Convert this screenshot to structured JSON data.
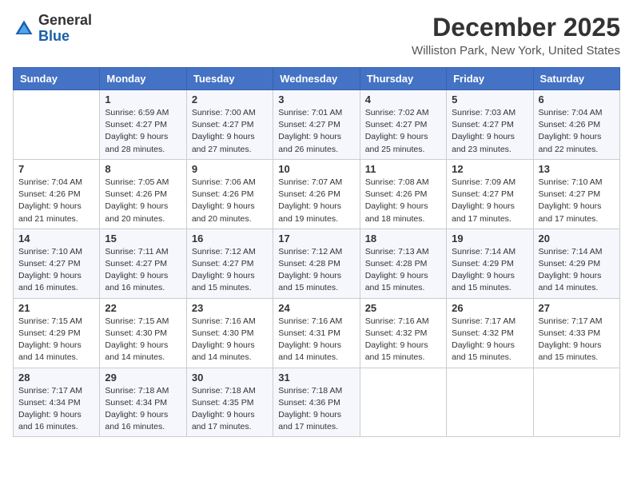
{
  "logo": {
    "general": "General",
    "blue": "Blue"
  },
  "header": {
    "month": "December 2025",
    "location": "Williston Park, New York, United States"
  },
  "weekdays": [
    "Sunday",
    "Monday",
    "Tuesday",
    "Wednesday",
    "Thursday",
    "Friday",
    "Saturday"
  ],
  "weeks": [
    [
      {
        "day": "",
        "sunrise": "",
        "sunset": "",
        "daylight": ""
      },
      {
        "day": "1",
        "sunrise": "Sunrise: 6:59 AM",
        "sunset": "Sunset: 4:27 PM",
        "daylight": "Daylight: 9 hours and 28 minutes."
      },
      {
        "day": "2",
        "sunrise": "Sunrise: 7:00 AM",
        "sunset": "Sunset: 4:27 PM",
        "daylight": "Daylight: 9 hours and 27 minutes."
      },
      {
        "day": "3",
        "sunrise": "Sunrise: 7:01 AM",
        "sunset": "Sunset: 4:27 PM",
        "daylight": "Daylight: 9 hours and 26 minutes."
      },
      {
        "day": "4",
        "sunrise": "Sunrise: 7:02 AM",
        "sunset": "Sunset: 4:27 PM",
        "daylight": "Daylight: 9 hours and 25 minutes."
      },
      {
        "day": "5",
        "sunrise": "Sunrise: 7:03 AM",
        "sunset": "Sunset: 4:27 PM",
        "daylight": "Daylight: 9 hours and 23 minutes."
      },
      {
        "day": "6",
        "sunrise": "Sunrise: 7:04 AM",
        "sunset": "Sunset: 4:26 PM",
        "daylight": "Daylight: 9 hours and 22 minutes."
      }
    ],
    [
      {
        "day": "7",
        "sunrise": "Sunrise: 7:04 AM",
        "sunset": "Sunset: 4:26 PM",
        "daylight": "Daylight: 9 hours and 21 minutes."
      },
      {
        "day": "8",
        "sunrise": "Sunrise: 7:05 AM",
        "sunset": "Sunset: 4:26 PM",
        "daylight": "Daylight: 9 hours and 20 minutes."
      },
      {
        "day": "9",
        "sunrise": "Sunrise: 7:06 AM",
        "sunset": "Sunset: 4:26 PM",
        "daylight": "Daylight: 9 hours and 20 minutes."
      },
      {
        "day": "10",
        "sunrise": "Sunrise: 7:07 AM",
        "sunset": "Sunset: 4:26 PM",
        "daylight": "Daylight: 9 hours and 19 minutes."
      },
      {
        "day": "11",
        "sunrise": "Sunrise: 7:08 AM",
        "sunset": "Sunset: 4:26 PM",
        "daylight": "Daylight: 9 hours and 18 minutes."
      },
      {
        "day": "12",
        "sunrise": "Sunrise: 7:09 AM",
        "sunset": "Sunset: 4:27 PM",
        "daylight": "Daylight: 9 hours and 17 minutes."
      },
      {
        "day": "13",
        "sunrise": "Sunrise: 7:10 AM",
        "sunset": "Sunset: 4:27 PM",
        "daylight": "Daylight: 9 hours and 17 minutes."
      }
    ],
    [
      {
        "day": "14",
        "sunrise": "Sunrise: 7:10 AM",
        "sunset": "Sunset: 4:27 PM",
        "daylight": "Daylight: 9 hours and 16 minutes."
      },
      {
        "day": "15",
        "sunrise": "Sunrise: 7:11 AM",
        "sunset": "Sunset: 4:27 PM",
        "daylight": "Daylight: 9 hours and 16 minutes."
      },
      {
        "day": "16",
        "sunrise": "Sunrise: 7:12 AM",
        "sunset": "Sunset: 4:27 PM",
        "daylight": "Daylight: 9 hours and 15 minutes."
      },
      {
        "day": "17",
        "sunrise": "Sunrise: 7:12 AM",
        "sunset": "Sunset: 4:28 PM",
        "daylight": "Daylight: 9 hours and 15 minutes."
      },
      {
        "day": "18",
        "sunrise": "Sunrise: 7:13 AM",
        "sunset": "Sunset: 4:28 PM",
        "daylight": "Daylight: 9 hours and 15 minutes."
      },
      {
        "day": "19",
        "sunrise": "Sunrise: 7:14 AM",
        "sunset": "Sunset: 4:29 PM",
        "daylight": "Daylight: 9 hours and 15 minutes."
      },
      {
        "day": "20",
        "sunrise": "Sunrise: 7:14 AM",
        "sunset": "Sunset: 4:29 PM",
        "daylight": "Daylight: 9 hours and 14 minutes."
      }
    ],
    [
      {
        "day": "21",
        "sunrise": "Sunrise: 7:15 AM",
        "sunset": "Sunset: 4:29 PM",
        "daylight": "Daylight: 9 hours and 14 minutes."
      },
      {
        "day": "22",
        "sunrise": "Sunrise: 7:15 AM",
        "sunset": "Sunset: 4:30 PM",
        "daylight": "Daylight: 9 hours and 14 minutes."
      },
      {
        "day": "23",
        "sunrise": "Sunrise: 7:16 AM",
        "sunset": "Sunset: 4:30 PM",
        "daylight": "Daylight: 9 hours and 14 minutes."
      },
      {
        "day": "24",
        "sunrise": "Sunrise: 7:16 AM",
        "sunset": "Sunset: 4:31 PM",
        "daylight": "Daylight: 9 hours and 14 minutes."
      },
      {
        "day": "25",
        "sunrise": "Sunrise: 7:16 AM",
        "sunset": "Sunset: 4:32 PM",
        "daylight": "Daylight: 9 hours and 15 minutes."
      },
      {
        "day": "26",
        "sunrise": "Sunrise: 7:17 AM",
        "sunset": "Sunset: 4:32 PM",
        "daylight": "Daylight: 9 hours and 15 minutes."
      },
      {
        "day": "27",
        "sunrise": "Sunrise: 7:17 AM",
        "sunset": "Sunset: 4:33 PM",
        "daylight": "Daylight: 9 hours and 15 minutes."
      }
    ],
    [
      {
        "day": "28",
        "sunrise": "Sunrise: 7:17 AM",
        "sunset": "Sunset: 4:34 PM",
        "daylight": "Daylight: 9 hours and 16 minutes."
      },
      {
        "day": "29",
        "sunrise": "Sunrise: 7:18 AM",
        "sunset": "Sunset: 4:34 PM",
        "daylight": "Daylight: 9 hours and 16 minutes."
      },
      {
        "day": "30",
        "sunrise": "Sunrise: 7:18 AM",
        "sunset": "Sunset: 4:35 PM",
        "daylight": "Daylight: 9 hours and 17 minutes."
      },
      {
        "day": "31",
        "sunrise": "Sunrise: 7:18 AM",
        "sunset": "Sunset: 4:36 PM",
        "daylight": "Daylight: 9 hours and 17 minutes."
      },
      {
        "day": "",
        "sunrise": "",
        "sunset": "",
        "daylight": ""
      },
      {
        "day": "",
        "sunrise": "",
        "sunset": "",
        "daylight": ""
      },
      {
        "day": "",
        "sunrise": "",
        "sunset": "",
        "daylight": ""
      }
    ]
  ]
}
